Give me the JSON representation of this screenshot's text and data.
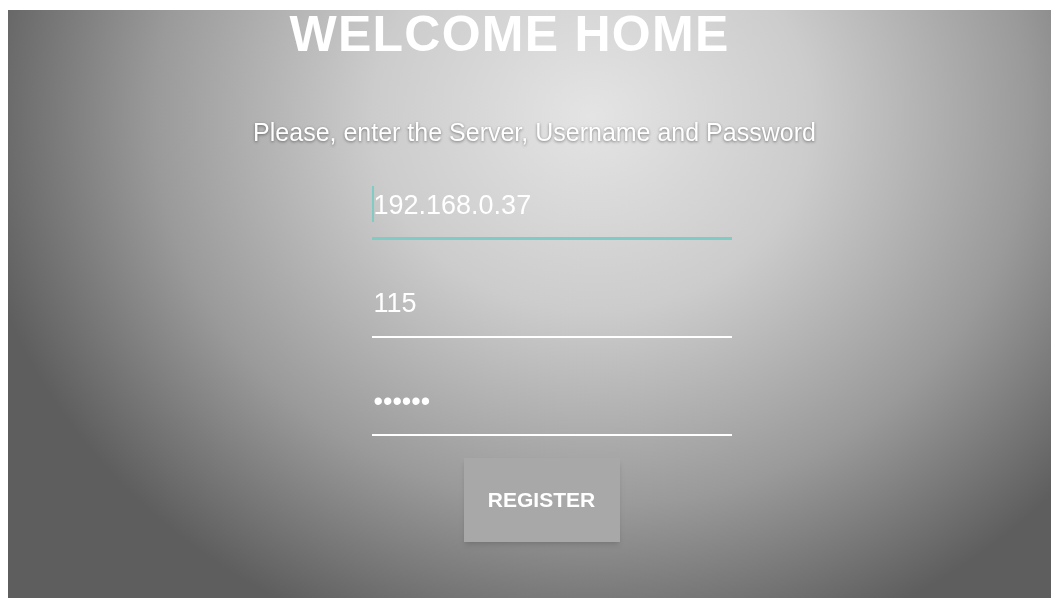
{
  "title": "WELCOME HOME",
  "subtitle": "Please, enter the Server, Username and Password",
  "fields": [
    {
      "value": "192.168.0.37",
      "focused": true
    },
    {
      "value": "115",
      "focused": false
    },
    {
      "value": "••••••",
      "focused": false
    }
  ],
  "button": "REGISTER"
}
